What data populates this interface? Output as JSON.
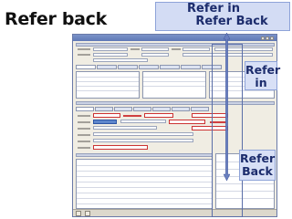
{
  "slide": {
    "title": "Refer back",
    "callout_top_line1": "Refer in",
    "callout_top_line2": "Refer Back",
    "callout_in_line1": "Refer",
    "callout_in_line2": "in",
    "callout_back_line1": "Refer",
    "callout_back_line2": "Back"
  },
  "colors": {
    "callout_bg": "#d3dcf4",
    "callout_text": "#1c2c6c",
    "arrow": "#6a80c0",
    "window_titlebar": "#6f86c0"
  },
  "window": {
    "controls": [
      "minimize",
      "maximize",
      "close"
    ],
    "footer_buttons": [
      "",
      ""
    ]
  }
}
